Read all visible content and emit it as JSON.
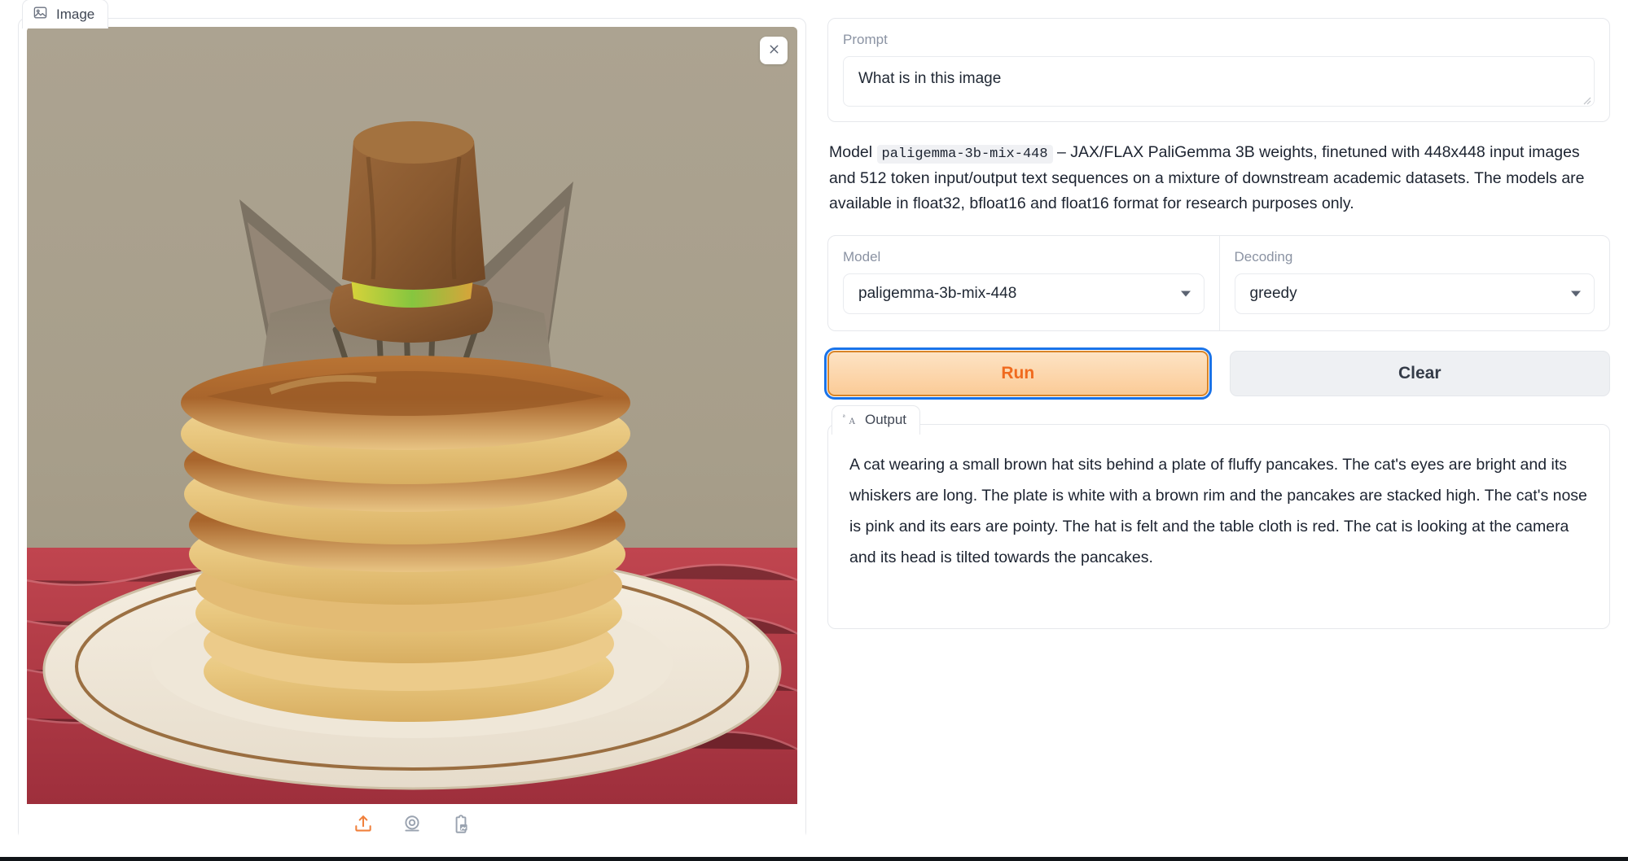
{
  "image_panel": {
    "tab_label": "Image",
    "tab_icon": "picture-icon",
    "close_icon": "close-icon",
    "toolbar": [
      {
        "icon": "upload-icon",
        "color": "#f0803c"
      },
      {
        "icon": "webcam-icon",
        "color": "#9aa3b0"
      },
      {
        "icon": "clipboard-paste-image-icon",
        "color": "#9aa3b0"
      }
    ],
    "photo_alt": "A tabby cat wearing a small brown felt top hat sitting behind a tall stack of pancakes on a cream plate with a brown rim, on a red cloth"
  },
  "prompt": {
    "label": "Prompt",
    "value": "What is in this image",
    "placeholder": "What is in this image"
  },
  "description": {
    "prefix": "Model ",
    "code": "paligemma-3b-mix-448",
    "body": " – JAX/FLAX PaliGemma 3B weights, finetuned with 448x448 input images and 512 token input/output text sequences on a mixture of downstream academic datasets. The models are available in float32, bfloat16 and float16 format for research purposes only."
  },
  "controls": {
    "model": {
      "label": "Model",
      "value": "paligemma-3b-mix-448"
    },
    "decoding": {
      "label": "Decoding",
      "value": "greedy"
    }
  },
  "buttons": {
    "run": "Run",
    "clear": "Clear"
  },
  "output": {
    "tab_label": "Output",
    "tab_icon": "text-format-icon",
    "text": "A cat wearing a small brown hat sits behind a plate of fluffy pancakes. The cat's eyes are bright and its whiskers are long. The plate is white with a brown rim and the pancakes are stacked high. The cat's nose is pink and its ears are pointy. The hat is felt and the table cloth is red. The cat is looking at the camera and its head is tilted towards the pancakes."
  },
  "colors": {
    "accent_orange": "#f0803c",
    "focus_blue": "#1a73e8",
    "run_text": "#f06a1e",
    "border": "#e6e8ec",
    "muted_text": "#8b93a3"
  }
}
